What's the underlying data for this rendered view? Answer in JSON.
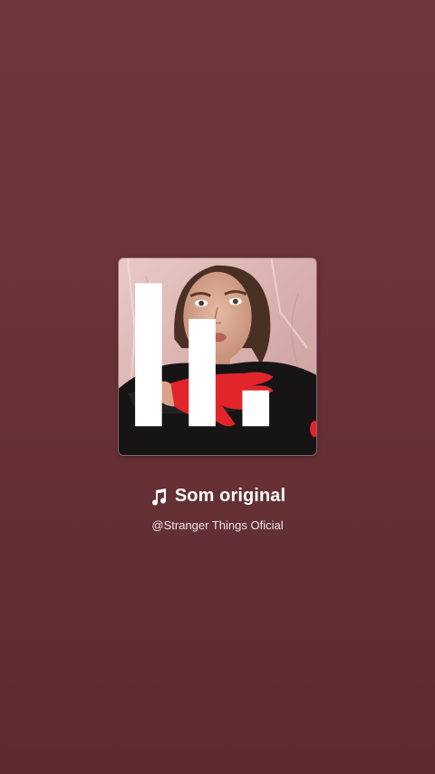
{
  "sound": {
    "title": "Som original",
    "author": "@Stranger Things Oficial"
  },
  "cover": {
    "alt": "Capa do som",
    "badge_icon": "bars-logo-icon"
  },
  "colors": {
    "background_top": "#6f373e",
    "background_bottom": "#5e2b30",
    "text": "#ffffff",
    "paint_red": "#e0262b"
  },
  "icons": {
    "note": "music-note-icon"
  }
}
